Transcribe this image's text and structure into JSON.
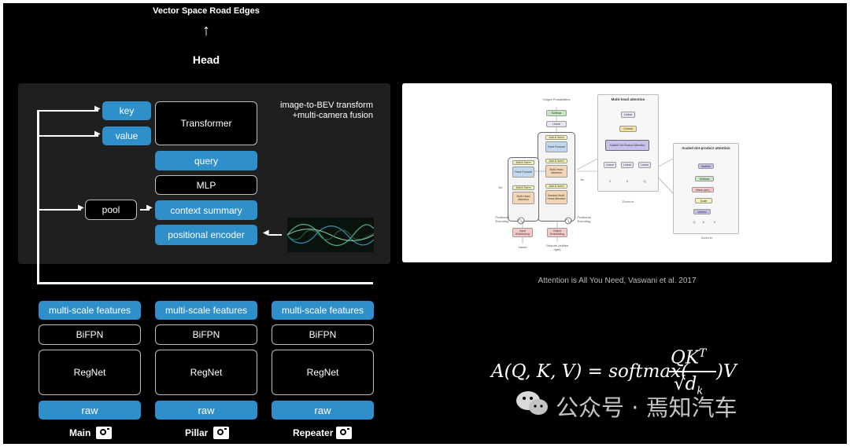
{
  "head": {
    "output_label": "Vector Space Road Edges",
    "arrow_glyph": "↑",
    "head_label": "Head"
  },
  "fusion_module": {
    "caption_line1": "image-to-BEV transform",
    "caption_line2": "+multi-camera fusion",
    "key": "key",
    "value": "value",
    "transformer": "Transformer",
    "query": "query",
    "mlp": "MLP",
    "pool": "pool",
    "context_summary": "context summary",
    "positional_encoder": "positional encoder"
  },
  "backbones": [
    {
      "features": "multi-scale features",
      "bifpn": "BiFPN",
      "regnet": "RegNet",
      "raw": "raw",
      "camera": "Main"
    },
    {
      "features": "multi-scale features",
      "bifpn": "BiFPN",
      "regnet": "RegNet",
      "raw": "raw",
      "camera": "Pillar"
    },
    {
      "features": "multi-scale features",
      "bifpn": "BiFPN",
      "regnet": "RegNet",
      "raw": "raw",
      "camera": "Repeater"
    }
  ],
  "paper_figure": {
    "multihead_title": "Multi-head attention",
    "sdpa_title": "Scaled dot-product attention",
    "output_probabilities": "Output Probabilities",
    "softmax": "Softmax",
    "linear": "Linear",
    "add_norm": "Add & Norm",
    "feed_forward": "Feed Forward",
    "multi_head_attention": "Multi-Head Attention",
    "masked_mha": "Masked Multi-Head Attention",
    "nx": "Nx",
    "positional_encoding": "Positional Encoding",
    "input_embedding": "Input Embedding",
    "output_embedding": "Output Embedding",
    "inputs": "Inputs",
    "outputs": "Outputs (shifted right)",
    "concat": "Concat",
    "scaled_dot": "Scaled Dot-Product Attention",
    "v": "V",
    "k": "K",
    "q": "Q",
    "matmul": "MatMul",
    "mask": "Mask (opt.)",
    "scale": "Scale",
    "zoom_in": "Zoom-in"
  },
  "citation": "Attention is All You Need, Vaswani et al. 2017",
  "formula": {
    "lhs": "A(Q, K, V) = softmax(",
    "numerator": "QK",
    "superscript": "T",
    "denominator": "√d",
    "subscript": "k",
    "rhs": ")V"
  },
  "watermark": {
    "label": "公众号 · 焉知汽车"
  },
  "colors": {
    "accent_blue": "#2f8fcb",
    "panel_bg": "#1f1f1f",
    "background": "#000000"
  }
}
